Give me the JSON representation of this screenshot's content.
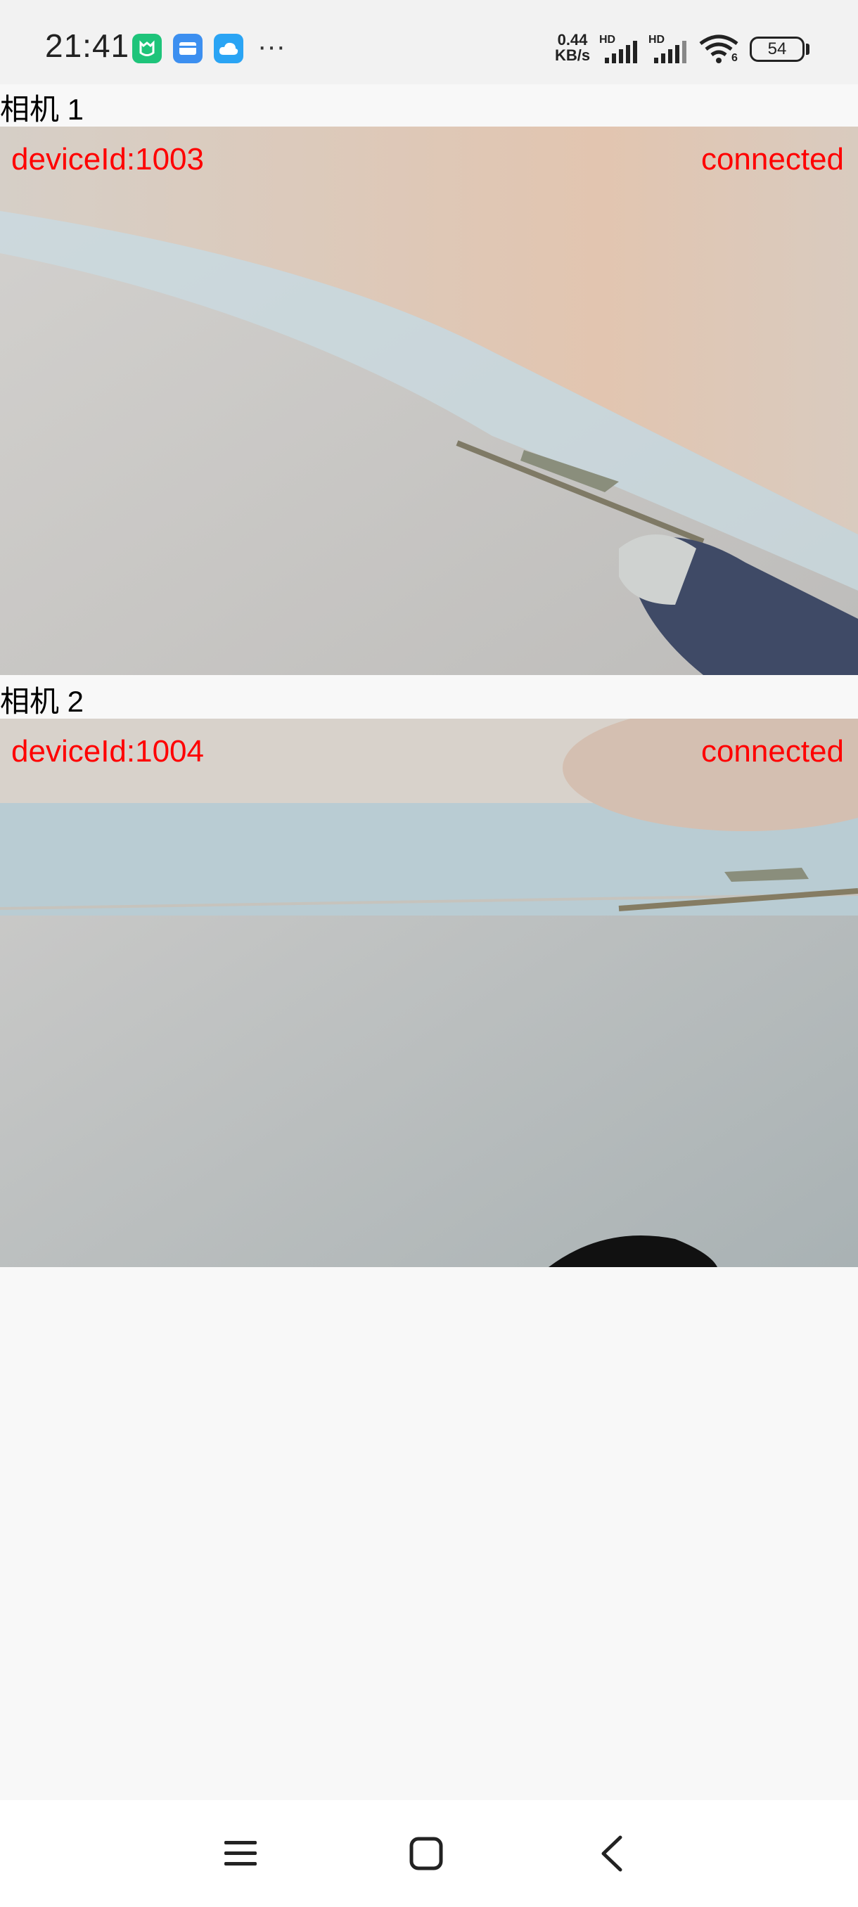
{
  "status_bar": {
    "time": "21:41",
    "more": "···",
    "net_speed_value": "0.44",
    "net_speed_unit": "KB/s",
    "signal_label": "HD",
    "wifi_label": "6",
    "battery": "54"
  },
  "cameras": [
    {
      "label": "相机 1",
      "device": "deviceId:1003",
      "status": "connected"
    },
    {
      "label": "相机 2",
      "device": "deviceId:1004",
      "status": "connected"
    }
  ],
  "colors": {
    "overlay_text": "#ff0000",
    "background": "#f8f8f8"
  }
}
